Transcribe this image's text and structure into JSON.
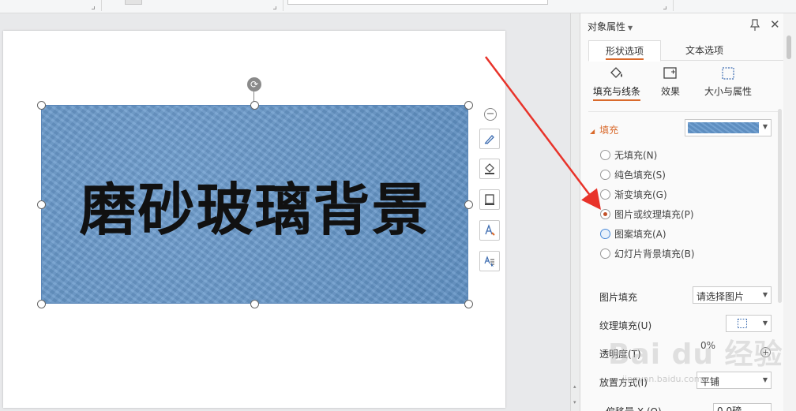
{
  "canvas": {
    "shape_text": "磨砂玻璃背景"
  },
  "panel": {
    "title": "对象属性",
    "tabs": [
      {
        "label": "形状选项",
        "active": true
      },
      {
        "label": "文本选项",
        "active": false
      }
    ],
    "subtabs": [
      {
        "label": "填充与线条",
        "icon": "paint-bucket-icon",
        "active": true
      },
      {
        "label": "效果",
        "icon": "effects-icon",
        "active": false
      },
      {
        "label": "大小与属性",
        "icon": "size-icon",
        "active": false
      }
    ],
    "fill_section": {
      "label": "填充",
      "color_value": "#6497cc"
    },
    "fill_options": [
      {
        "label": "无填充(N)",
        "checked": false
      },
      {
        "label": "纯色填充(S)",
        "checked": false
      },
      {
        "label": "渐变填充(G)",
        "checked": false
      },
      {
        "label": "图片或纹理填充(P)",
        "checked": true
      },
      {
        "label": "图案填充(A)",
        "checked": false
      },
      {
        "label": "幻灯片背景填充(B)",
        "checked": false
      }
    ],
    "picture_fill": {
      "label": "图片填充",
      "value": "请选择图片"
    },
    "texture_fill": {
      "label": "纹理填充(U)"
    },
    "transparency": {
      "label": "透明度(T)",
      "value": "0%"
    },
    "placement": {
      "label": "放置方式(I)",
      "value": "平铺"
    },
    "offset": {
      "label": "偏移量 X (O)",
      "value": "0.0磅"
    }
  },
  "watermark": {
    "text": "Bai du 经验",
    "sub": "jingyan.baidu.com"
  },
  "colors": {
    "accent": "#d96a2c",
    "shape_fill": "#6497cc",
    "arrow": "#e8332a"
  }
}
